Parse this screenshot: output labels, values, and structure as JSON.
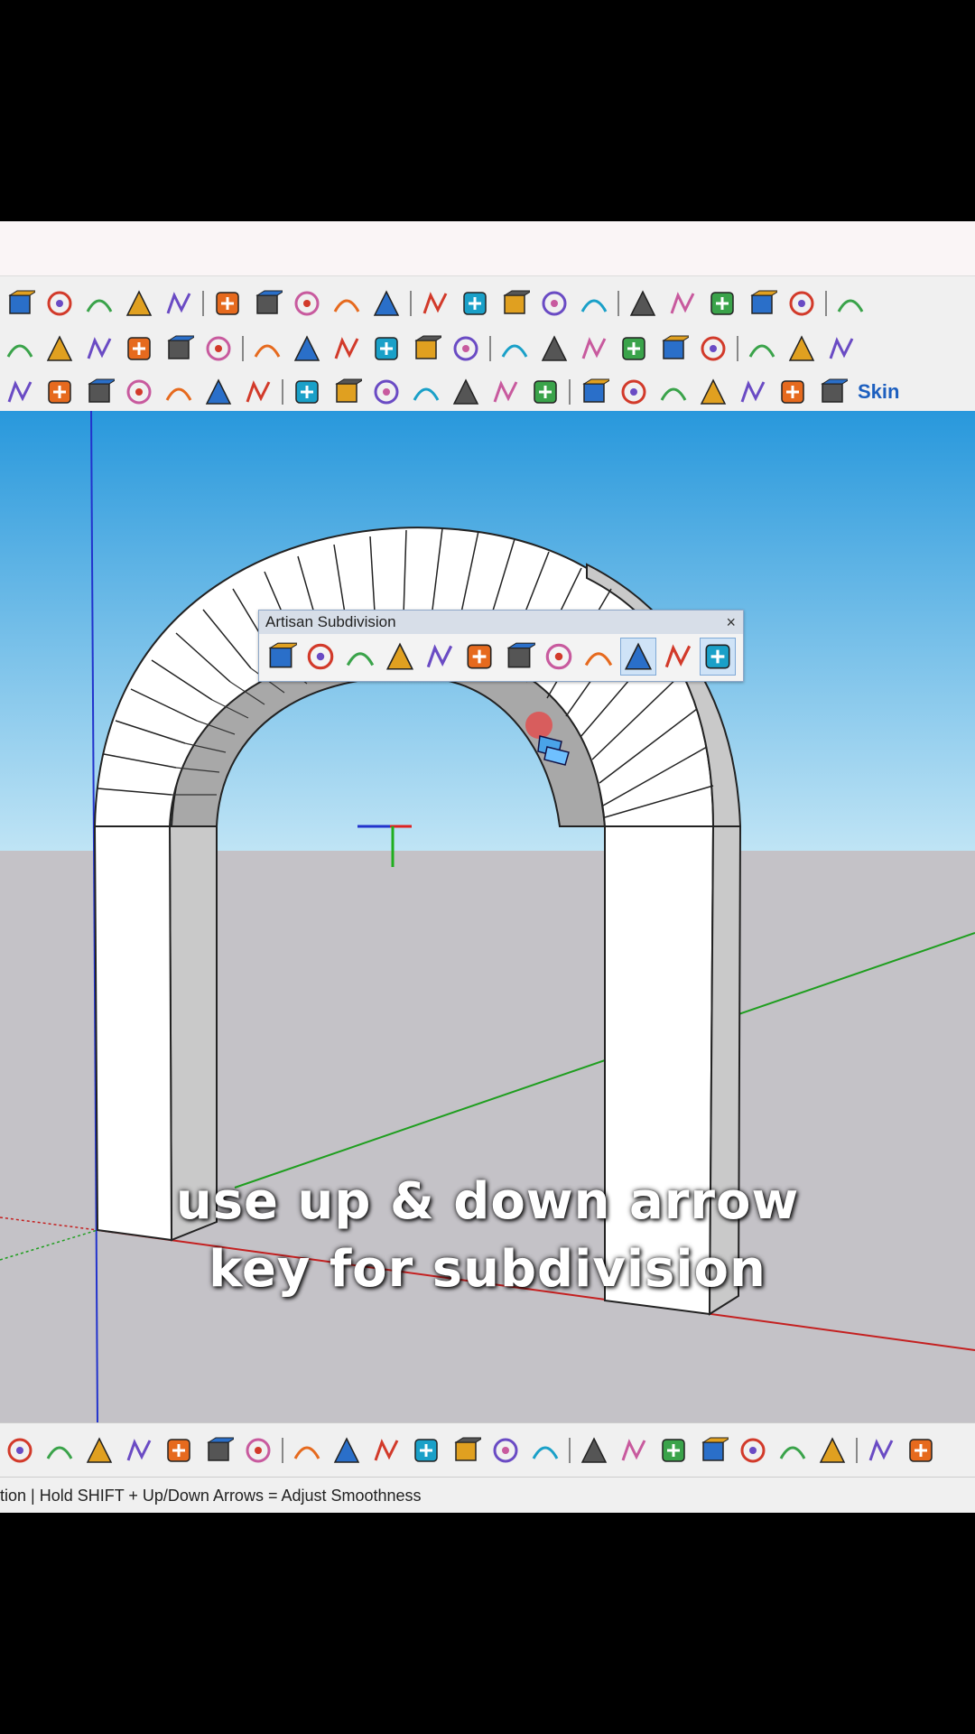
{
  "floating_panel": {
    "title": "Artisan Subdivision",
    "close_label": "×"
  },
  "toolbar_misc": {
    "skin_label": "Skin"
  },
  "viewport": {
    "sky_color": "#3aa3e0",
    "ground_color": "#c4c2c7"
  },
  "status_bar": {
    "text": "tion  |  Hold SHIFT + Up/Down Arrows = Adjust Smoothness"
  },
  "caption": {
    "line1": "use up & down arrow",
    "line2": "key for subdivision"
  },
  "toolbar_row1_icons": [
    "orbit-pencil-icon",
    "section-plane-icon",
    "pan-hand-icon",
    "zoom-icon",
    "zoom-extents-icon",
    "component-options-icon",
    "layers-icon",
    "stacked-layers-icon",
    "tags-icon",
    "account-icon",
    "dropdown-arrow-icon",
    "new-file-icon",
    "add-user-icon",
    "extension-p-icon",
    "cube-wire-icon",
    "orbit-target-icon",
    "video-camera-icon",
    "camera-icon",
    "position-camera-icon",
    "settings-gear-icon",
    "export-cube-icon"
  ],
  "toolbar_row2_icons": [
    "solid-tools-icon",
    "shape-icon",
    "surface-icon",
    "mesh-surface-icon",
    "curved-surface-icon",
    "surface-flip-icon",
    "twist-icon",
    "bend-icon",
    "drape-icon",
    "text-tool-icon",
    "grid-mesh-icon",
    "network-icon",
    "shield-cube-icon",
    "gear-cube-icon",
    "green-cube-icon",
    "broom-icon",
    "gear-icon",
    "hand-pointer-icon",
    "table-icon",
    "flip-icon",
    "burst-icon"
  ],
  "toolbar_row3_icons": [
    "spiral-icon",
    "arc-icon",
    "zigzag-icon",
    "curve-icon",
    "arc2-icon",
    "arc3-icon",
    "polyline-icon",
    "circle-icon",
    "wrench-icon",
    "ellipse-icon",
    "triangle-icon",
    "fold-icon",
    "house-icon",
    "push-up-icon",
    "push-down-icon",
    "push-blue-icon",
    "push-red-icon",
    "push-green-icon",
    "push-n-icon",
    "push-orange-icon",
    "push-pink-icon"
  ],
  "panel_icons": [
    "subd-shield-icon",
    "subd-cube-icon",
    "subd-dome-icon",
    "subd-diamond-icon",
    "subd-extrude-icon",
    "subd-grid-icon",
    "subd-face-icon",
    "subd-sword-icon",
    "subd-crease-icon",
    "subd-loop-cut-icon",
    "subd-split-icon",
    "subd-box-icon"
  ],
  "bottom_icons": [
    "lasso-icon",
    "select-icon",
    "box-select-icon",
    "soft-select-icon",
    "component-select-icon",
    "arrow-left-icon",
    "arrow-right-icon",
    "ruler-icon",
    "move-points-icon",
    "scale-points-icon",
    "axis-icon",
    "drop-icon",
    "terrain-icon",
    "view-cube-icon",
    "paint-remove-icon",
    "paint-remove2-icon",
    "paint-remove3-icon",
    "tag-remove-icon",
    "tag-remove2-icon",
    "tag-remove3-icon",
    "sphere-icon",
    "cone-icon",
    "cylinder-icon"
  ]
}
